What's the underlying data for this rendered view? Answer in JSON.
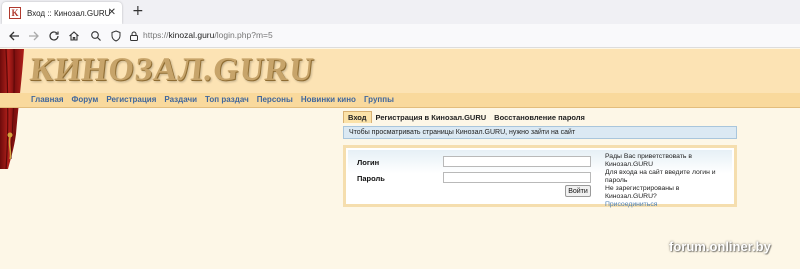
{
  "browser": {
    "tab_title": "Вход :: Кинозал.GURU",
    "favicon_letter": "K",
    "url_scheme": "https://",
    "url_host": "kinozal.guru",
    "url_path": "/login.php?m=5"
  },
  "site": {
    "logo": "КИНОЗАЛ.GURU",
    "menu": [
      "Главная",
      "Форум",
      "Регистрация",
      "Раздачи",
      "Топ раздач",
      "Персоны",
      "Новинки кино",
      "Группы"
    ]
  },
  "subtabs": [
    "Вход",
    "Регистрация в Кинозал.GURU",
    "Восстановление пароля"
  ],
  "notice": "Чтобы просматривать страницы Кинозал.GURU, нужно зайти на сайт",
  "login": {
    "username_label": "Логин",
    "password_label": "Пароль",
    "submit_label": "Войти",
    "welcome_lines": [
      "Рады Вас приветствовать в Кинозал.GURU",
      "Для входа на сайт введите логин и пароль",
      "Не зарегистрированы в Кинозал.GURU?"
    ],
    "join_link": "Присоединиться"
  },
  "watermark": "forum.onliner.by",
  "colors": {
    "menu_link": "#40679c",
    "header_band": "#fce3b4",
    "menu_band": "#f9d99c",
    "info_bar": "#dbe9f3"
  }
}
